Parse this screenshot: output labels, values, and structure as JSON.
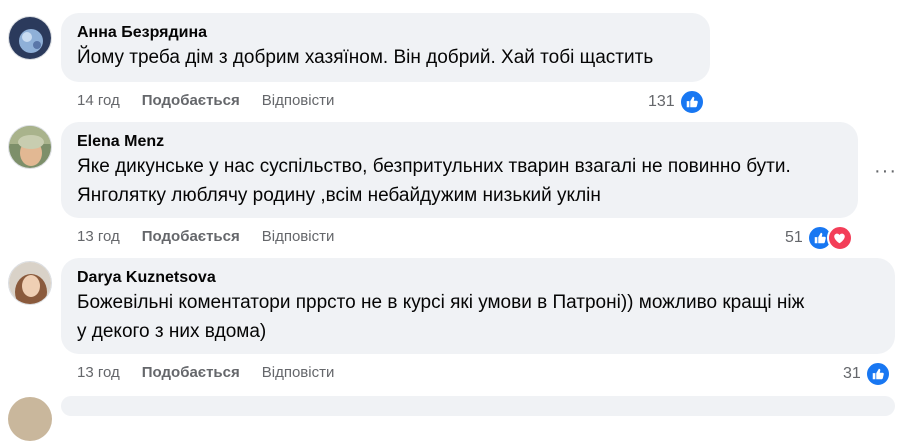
{
  "comments": [
    {
      "author": "Анна Безрядина",
      "lines": [
        "Йому треба дім з добрим хазяїном. Він добрий. Хай тобі щастить"
      ],
      "time": "14 год",
      "like_label": "Подобається",
      "reply_label": "Відповісти",
      "reaction_count": "131",
      "reactions": [
        "like"
      ]
    },
    {
      "author": "Elena Menz",
      "lines": [
        "Яке дикунське у нас суспільство, безпритульних тварин взагалі не повинно бути.",
        "Янголятку люблячу родину ,всім небайдужим низький уклін"
      ],
      "time": "13 год",
      "like_label": "Подобається",
      "reply_label": "Відповісти",
      "reaction_count": "51",
      "reactions": [
        "like",
        "love"
      ],
      "more_label": "···"
    },
    {
      "author": "Darya Kuznetsova",
      "lines": [
        "Божевільні коментатори пррсто не в курсі які умови в Патроні)) можливо кращі ніж",
        "у декого з них вдома)"
      ],
      "time": "13 год",
      "like_label": "Подобається",
      "reply_label": "Відповісти",
      "reaction_count": "31",
      "reactions": [
        "like"
      ]
    }
  ],
  "colors": {
    "bubble": "#f0f2f5",
    "like_blue": "#1877f2",
    "love_red": "#f33e58",
    "meta_gray": "#65676b"
  }
}
